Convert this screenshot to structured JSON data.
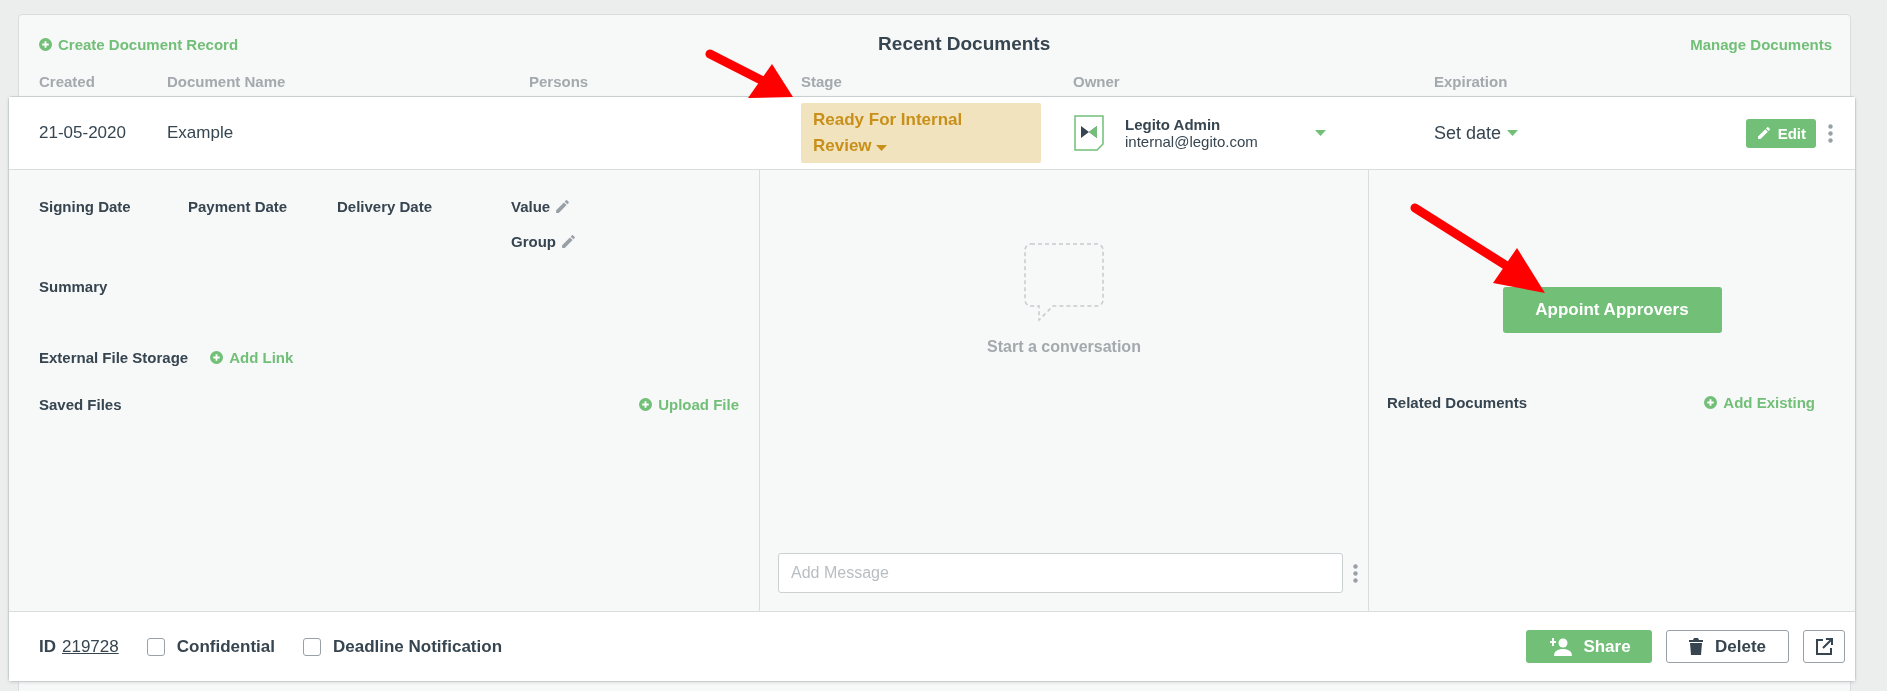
{
  "header": {
    "create_link": "Create Document Record",
    "title": "Recent Documents",
    "manage_link": "Manage Documents"
  },
  "columns": [
    "Created",
    "Document Name",
    "Persons",
    "Stage",
    "Owner",
    "Expiration"
  ],
  "document": {
    "created": "21-05-2020",
    "name": "Example",
    "stage": "Ready For Internal Review",
    "owner_name": "Legito Admin",
    "owner_email": "internal@legito.com",
    "expiration": "Set date",
    "edit_button": "Edit"
  },
  "details": {
    "date_fields": [
      "Signing Date",
      "Payment Date",
      "Delivery Date"
    ],
    "value_label": "Value",
    "group_label": "Group",
    "summary_label": "Summary",
    "external_storage_label": "External File Storage",
    "add_link": "Add Link",
    "saved_files_label": "Saved Files",
    "upload_file": "Upload File"
  },
  "conversation": {
    "empty_text": "Start a conversation",
    "message_placeholder": "Add Message"
  },
  "approvals": {
    "appoint_button": "Appoint Approvers",
    "related_label": "Related Documents",
    "add_existing": "Add Existing"
  },
  "footer": {
    "id_label": "ID",
    "id_value": "219728",
    "checkboxes": [
      {
        "label": "Confidential",
        "checked": false
      },
      {
        "label": "Deadline Notification",
        "checked": false
      }
    ],
    "share_button": "Share",
    "delete_button": "Delete"
  }
}
